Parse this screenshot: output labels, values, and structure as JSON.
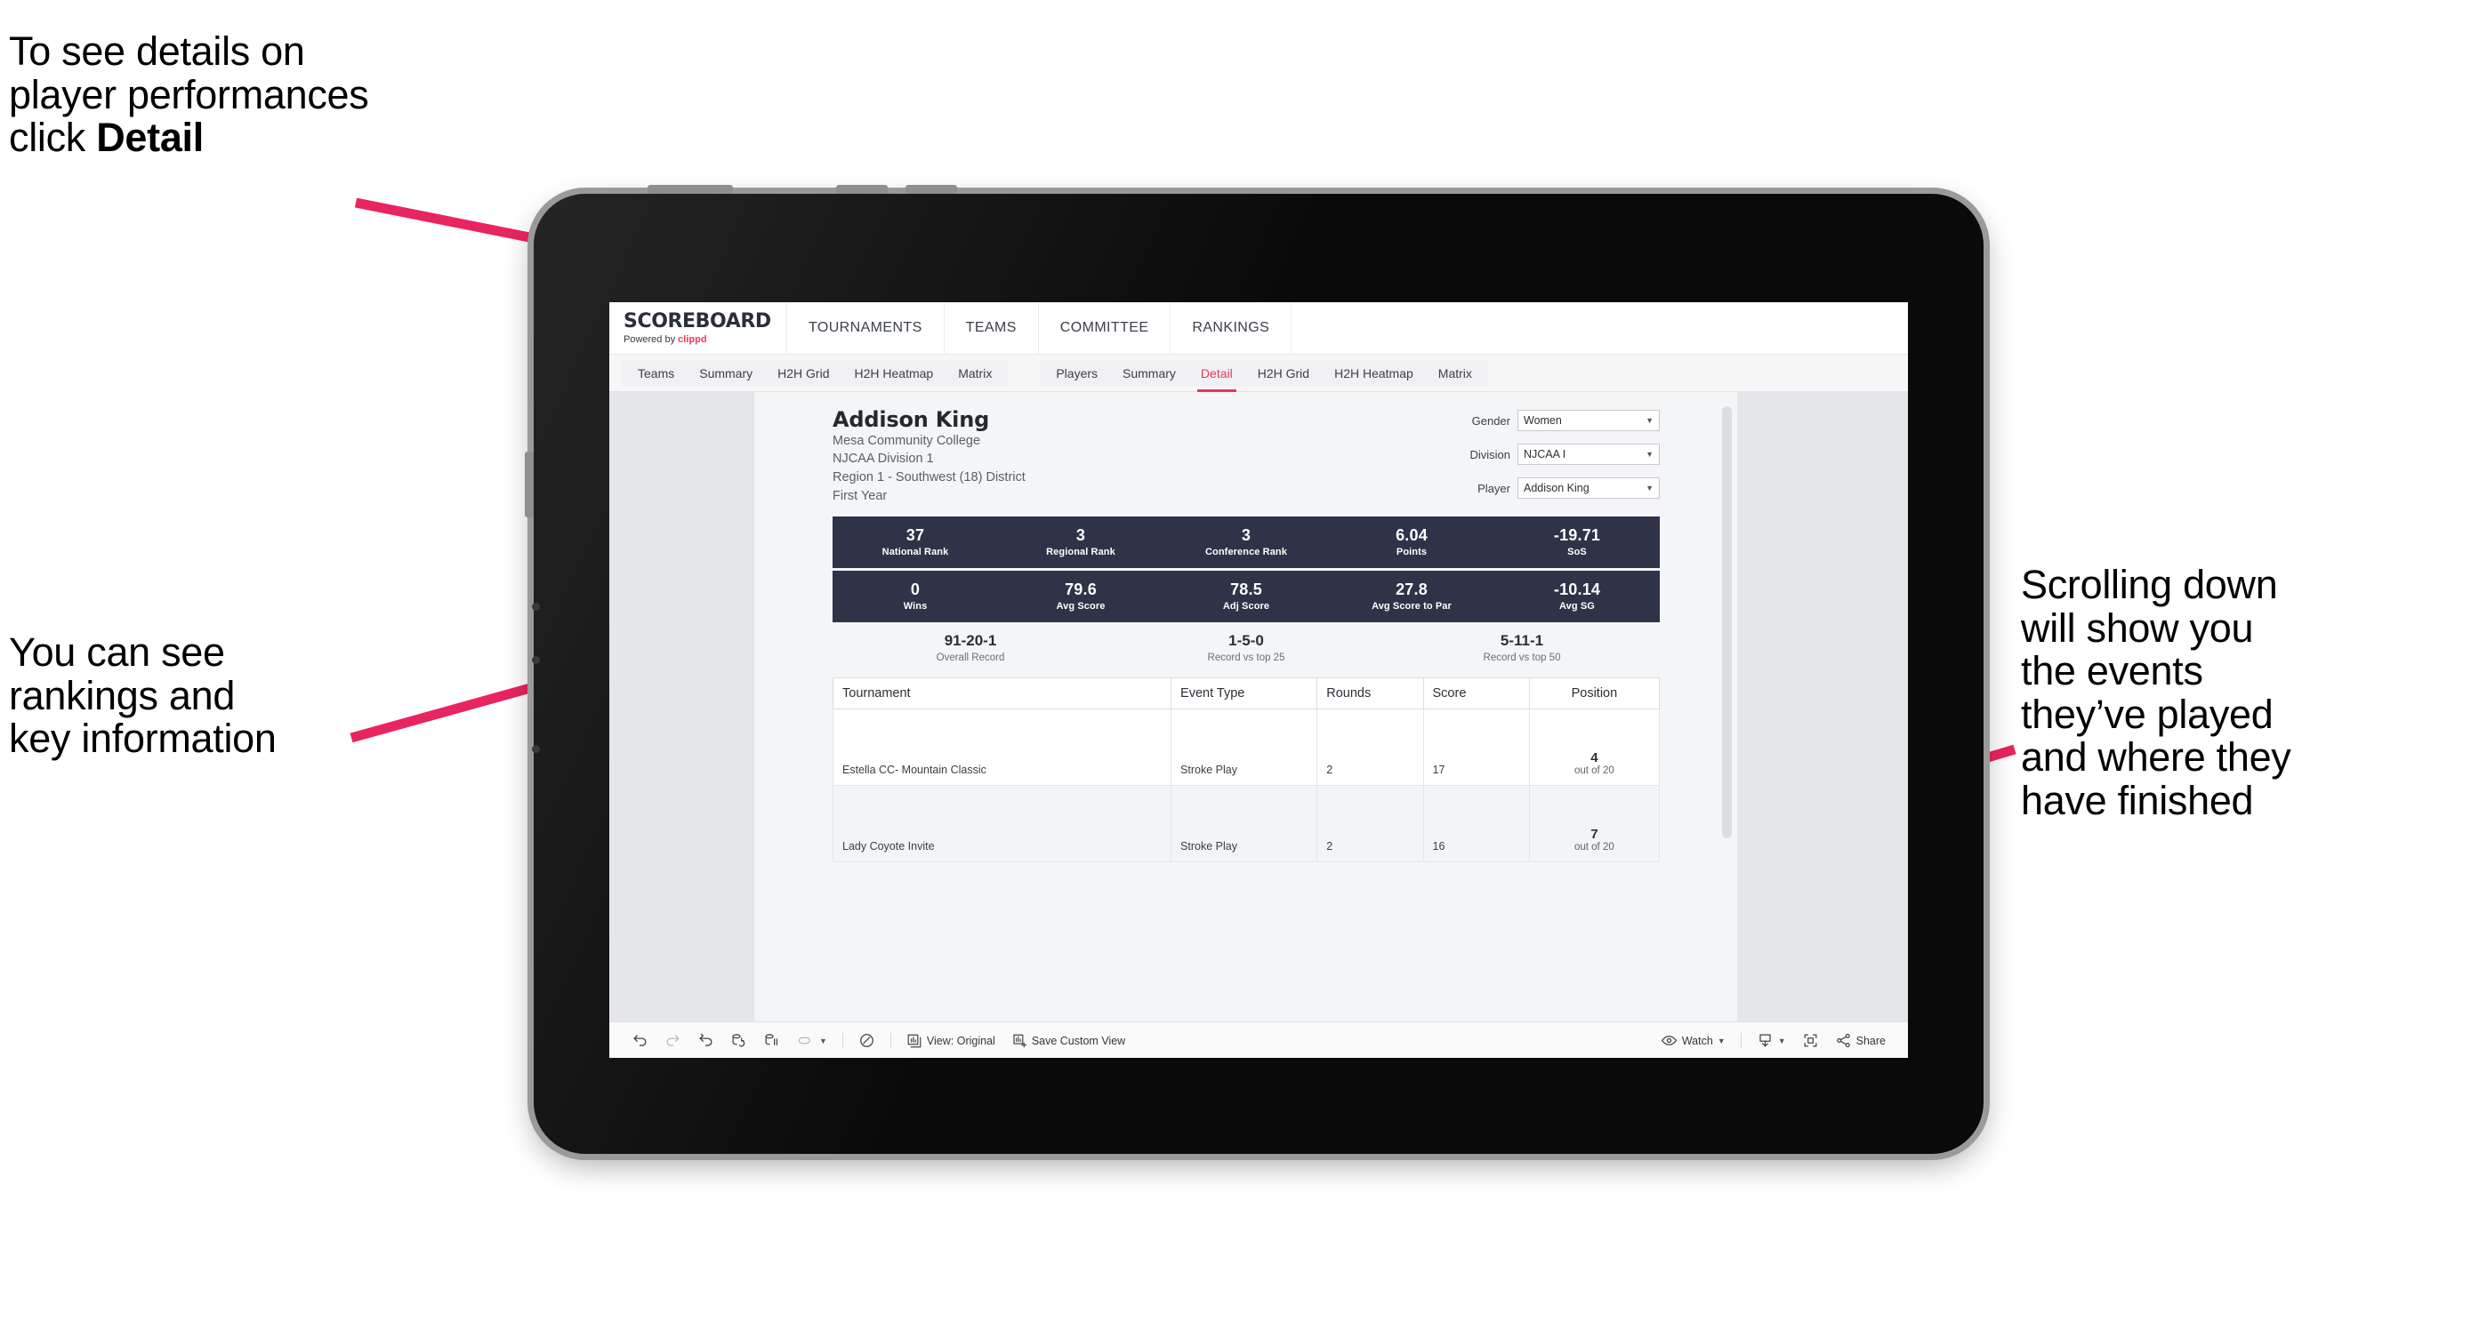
{
  "annotations": {
    "top_left": "To see details on\nplayer performances\nclick ",
    "top_left_bold": "Detail",
    "mid_left": "You can see\nrankings and\nkey information",
    "right": "Scrolling down\nwill show you\nthe events\nthey’ve played\nand where they\nhave finished",
    "arrow_color": "#e8255f"
  },
  "app": {
    "logo_word": "SCOREBOARD",
    "logo_sub_prefix": "Powered by ",
    "logo_brand": "clippd",
    "top_nav": [
      "TOURNAMENTS",
      "TEAMS",
      "COMMITTEE",
      "RANKINGS"
    ],
    "sub_nav_group_1": [
      "Teams",
      "Summary",
      "H2H Grid",
      "H2H Heatmap",
      "Matrix"
    ],
    "sub_nav_group_2": [
      "Players",
      "Summary",
      "Detail",
      "H2H Grid",
      "H2H Heatmap",
      "Matrix"
    ],
    "active_sub_tab": "Detail",
    "accent_color": "#e8365d",
    "stat_bar_color": "#2e3347"
  },
  "player": {
    "name": "Addison King",
    "college": "Mesa Community College",
    "division": "NJCAA Division 1",
    "region": "Region 1 - Southwest (18) District",
    "year": "First Year"
  },
  "filters": [
    {
      "label": "Gender",
      "value": "Women"
    },
    {
      "label": "Division",
      "value": "NJCAA I"
    },
    {
      "label": "Player",
      "value": "Addison King"
    }
  ],
  "stats_row_1": [
    {
      "value": "37",
      "label": "National Rank"
    },
    {
      "value": "3",
      "label": "Regional Rank"
    },
    {
      "value": "3",
      "label": "Conference Rank"
    },
    {
      "value": "6.04",
      "label": "Points"
    },
    {
      "value": "-19.71",
      "label": "SoS"
    }
  ],
  "stats_row_2": [
    {
      "value": "0",
      "label": "Wins"
    },
    {
      "value": "79.6",
      "label": "Avg Score"
    },
    {
      "value": "78.5",
      "label": "Adj Score"
    },
    {
      "value": "27.8",
      "label": "Avg Score to Par"
    },
    {
      "value": "-10.14",
      "label": "Avg SG"
    }
  ],
  "records": [
    {
      "value": "91-20-1",
      "label": "Overall Record"
    },
    {
      "value": "1-5-0",
      "label": "Record vs top 25"
    },
    {
      "value": "5-11-1",
      "label": "Record vs top 50"
    }
  ],
  "table": {
    "headers": [
      "Tournament",
      "Event Type",
      "Rounds",
      "Score",
      "Position"
    ],
    "rows": [
      {
        "tournament": "Estella CC- Mountain Classic",
        "event_type": "Stroke Play",
        "rounds": "2",
        "score": "17",
        "position_num": "4",
        "position_sub": "out of 20"
      },
      {
        "tournament": "Lady Coyote Invite",
        "event_type": "Stroke Play",
        "rounds": "2",
        "score": "16",
        "position_num": "7",
        "position_sub": "out of 20"
      }
    ]
  },
  "toolbar": {
    "view_label": "View: Original",
    "save_label": "Save Custom View",
    "watch_label": "Watch",
    "share_label": "Share"
  }
}
